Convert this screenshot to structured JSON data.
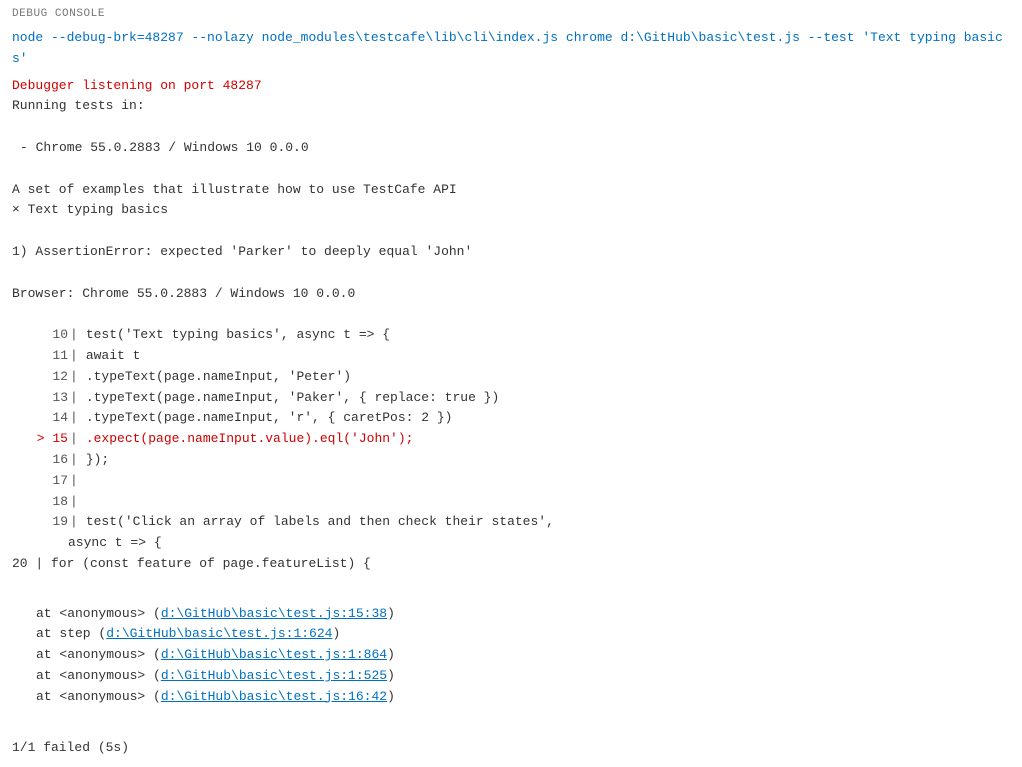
{
  "header": {
    "title": "DEBUG CONSOLE"
  },
  "command_line": "node --debug-brk=48287 --nolazy node_modules\\testcafe\\lib\\cli\\index.js chrome d:\\GitHub\\basic\\test.js --test 'Text typing basics'",
  "debugger_line": "Debugger listening on port 48287",
  "running_tests": " Running tests in:",
  "empty1": "",
  "browser_line": "- Chrome 55.0.2883 / Windows 10 0.0.0",
  "empty2": "",
  "test_suite": "A set of examples that illustrate how to use TestCafe API",
  "test_fail": "× Text typing basics",
  "empty3": "",
  "error_header": "  1) AssertionError: expected 'Parker' to deeply equal 'John'",
  "empty4": "",
  "browser_info": "     Browser: Chrome 55.0.2883 / Windows 10 0.0.0",
  "empty5": "",
  "code_lines": [
    {
      "num": "10",
      "pipe": "|",
      "content": "test('Text typing basics', async t => {",
      "highlight": false,
      "arrow": false
    },
    {
      "num": "11",
      "pipe": "|",
      "content": "    await t",
      "highlight": false,
      "arrow": false
    },
    {
      "num": "12",
      "pipe": "|",
      "content": "        .typeText(page.nameInput, 'Peter')",
      "highlight": false,
      "arrow": false
    },
    {
      "num": "13",
      "pipe": "|",
      "content": "        .typeText(page.nameInput, 'Paker', { replace: true })",
      "highlight": false,
      "arrow": false
    },
    {
      "num": "14",
      "pipe": "|",
      "content": "        .typeText(page.nameInput, 'r', { caretPos: 2 })",
      "highlight": false,
      "arrow": false
    },
    {
      "num": "15",
      "pipe": "|",
      "content": "        .expect(page.nameInput.value).eql('John');",
      "highlight": true,
      "arrow": true
    },
    {
      "num": "16",
      "pipe": "|",
      "content": "});",
      "highlight": false,
      "arrow": false
    },
    {
      "num": "17",
      "pipe": "|",
      "content": "",
      "highlight": false,
      "arrow": false
    },
    {
      "num": "18",
      "pipe": "|",
      "content": "",
      "highlight": false,
      "arrow": false
    },
    {
      "num": "19",
      "pipe": "|",
      "content": "test('Click an array of labels and then check their states',",
      "highlight": false,
      "arrow": false
    }
  ],
  "async_line": "    async t => {",
  "for_line": "    20 |    for (const feature of page.featureList) {",
  "empty6": "",
  "stack_lines": [
    {
      "prefix": "    at <anonymous> (",
      "link": "d:\\GitHub\\basic\\test.js:15:38",
      "suffix": ")"
    },
    {
      "prefix": "    at step (",
      "link": "d:\\GitHub\\basic\\test.js:1:624",
      "suffix": ")"
    },
    {
      "prefix": "    at <anonymous> (",
      "link": "d:\\GitHub\\basic\\test.js:1:864",
      "suffix": ")"
    },
    {
      "prefix": "    at <anonymous> (",
      "link": "d:\\GitHub\\basic\\test.js:1:525",
      "suffix": ")"
    },
    {
      "prefix": "    at <anonymous> (",
      "link": "d:\\GitHub\\basic\\test.js:16:42",
      "suffix": ")"
    }
  ],
  "footer": {
    "result": "1/1 failed (5s)"
  }
}
